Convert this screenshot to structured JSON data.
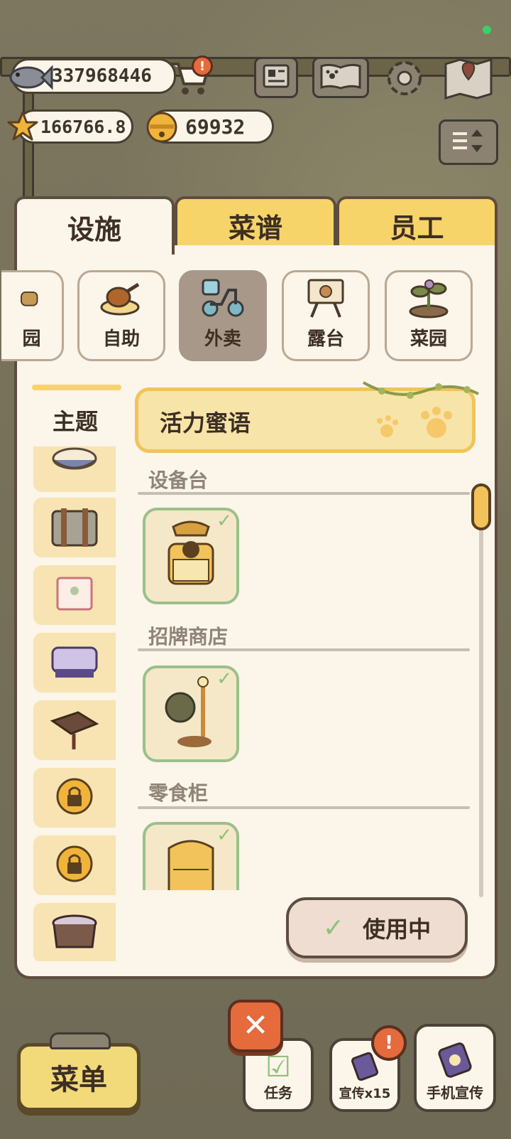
{
  "hud": {
    "fish_value": "337968446",
    "star_value": "166766.8",
    "bell_value": "69932"
  },
  "tabs": [
    {
      "label": "设施",
      "active": true
    },
    {
      "label": "菜谱",
      "active": false
    },
    {
      "label": "员工",
      "active": false
    }
  ],
  "categories": [
    {
      "label": "园",
      "icon": "teapot-icon"
    },
    {
      "label": "自助",
      "icon": "chicken-leg-icon"
    },
    {
      "label": "外卖",
      "icon": "scooter-icon",
      "active": true
    },
    {
      "label": "露台",
      "icon": "screen-icon"
    },
    {
      "label": "菜园",
      "icon": "sprout-icon"
    }
  ],
  "sidebar": {
    "title": "主题"
  },
  "theme_banner": {
    "label": "活力蜜语"
  },
  "sections": [
    {
      "title": "设备台",
      "item_icon": "rotary-phone-icon",
      "equipped": true
    },
    {
      "title": "招牌商店",
      "item_icon": "flower-signpost-icon",
      "equipped": true
    },
    {
      "title": "零食柜",
      "item_icon": "snack-cabinet-icon",
      "equipped": true
    }
  ],
  "in_use_button": {
    "label": "使用中"
  },
  "bottom_bar": {
    "menu_label": "菜单",
    "task_label": "任务",
    "promo_label": "宣传x15",
    "phone_promo_label": "手机宣传"
  },
  "colors": {
    "panel_bg": "#fbf5ea",
    "tab_yellow": "#f7d46a",
    "accent_green": "#8fc079",
    "close_red": "#e56a3c"
  }
}
